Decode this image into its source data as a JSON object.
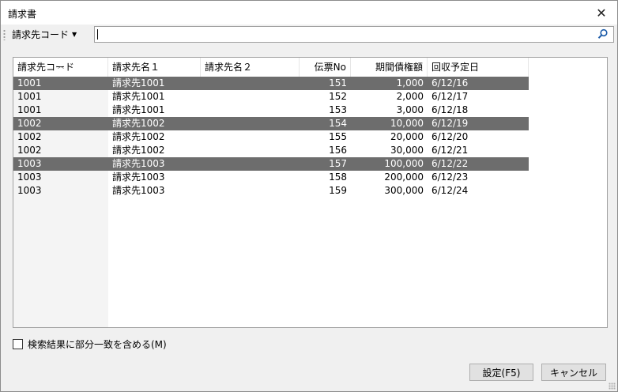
{
  "window": {
    "title": "請求書"
  },
  "toolbar": {
    "code_dropdown_label": "請求先コード",
    "search_value": ""
  },
  "table": {
    "columns": [
      "請求先コード",
      "請求先名１",
      "請求先名２",
      "伝票No",
      "期間債権額",
      "回収予定日"
    ],
    "rows": [
      {
        "code": "1001",
        "name1": "請求先1001",
        "name2": "",
        "slip": "151",
        "amount": "1,000",
        "date": "6/12/16",
        "selected": true
      },
      {
        "code": "1001",
        "name1": "請求先1001",
        "name2": "",
        "slip": "152",
        "amount": "2,000",
        "date": "6/12/17",
        "selected": false
      },
      {
        "code": "1001",
        "name1": "請求先1001",
        "name2": "",
        "slip": "153",
        "amount": "3,000",
        "date": "6/12/18",
        "selected": false
      },
      {
        "code": "1002",
        "name1": "請求先1002",
        "name2": "",
        "slip": "154",
        "amount": "10,000",
        "date": "6/12/19",
        "selected": true
      },
      {
        "code": "1002",
        "name1": "請求先1002",
        "name2": "",
        "slip": "155",
        "amount": "20,000",
        "date": "6/12/20",
        "selected": false
      },
      {
        "code": "1002",
        "name1": "請求先1002",
        "name2": "",
        "slip": "156",
        "amount": "30,000",
        "date": "6/12/21",
        "selected": false
      },
      {
        "code": "1003",
        "name1": "請求先1003",
        "name2": "",
        "slip": "157",
        "amount": "100,000",
        "date": "6/12/22",
        "selected": true
      },
      {
        "code": "1003",
        "name1": "請求先1003",
        "name2": "",
        "slip": "158",
        "amount": "200,000",
        "date": "6/12/23",
        "selected": false
      },
      {
        "code": "1003",
        "name1": "請求先1003",
        "name2": "",
        "slip": "159",
        "amount": "300,000",
        "date": "6/12/24",
        "selected": false
      }
    ]
  },
  "options": {
    "partial_match_label": "検索結果に部分一致を含める(M)",
    "partial_match_checked": false
  },
  "buttons": {
    "ok_label": "設定(F5)",
    "cancel_label": "キャンセル"
  },
  "colors": {
    "selected_row": "#6d6d6d",
    "window_bg": "#f0f0f0"
  }
}
